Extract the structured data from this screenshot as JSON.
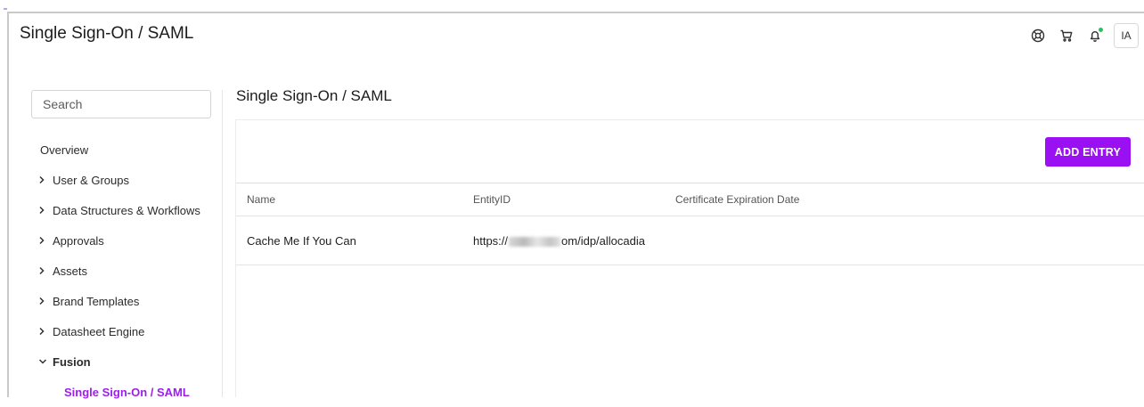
{
  "app": {
    "title": "Single Sign-On / SAML",
    "avatar_initials": "IA"
  },
  "header_icons": [
    "help-icon",
    "cart-icon",
    "bell-icon"
  ],
  "sidebar": {
    "search_placeholder": "Search",
    "items": [
      {
        "label": "Overview",
        "type": "plain"
      },
      {
        "label": "User & Groups",
        "type": "collapsed"
      },
      {
        "label": "Data Structures & Workflows",
        "type": "collapsed"
      },
      {
        "label": "Approvals",
        "type": "collapsed"
      },
      {
        "label": "Assets",
        "type": "collapsed"
      },
      {
        "label": "Brand Templates",
        "type": "collapsed"
      },
      {
        "label": "Datasheet Engine",
        "type": "collapsed"
      },
      {
        "label": "Fusion",
        "type": "expanded"
      },
      {
        "label": "Single Sign-On / SAML",
        "type": "active-sub"
      }
    ]
  },
  "main": {
    "page_title": "Single Sign-On / SAML",
    "add_button_label": "ADD ENTRY",
    "table": {
      "columns": [
        "Name",
        "EntityID",
        "Certificate Expiration Date"
      ],
      "rows": [
        {
          "name": "Cache Me If You Can",
          "entity_prefix": "https://",
          "entity_suffix": "om/idp/allocadia",
          "expiration": ""
        }
      ]
    }
  },
  "colors": {
    "accent": "#9b10f2",
    "notification": "#22c55e"
  }
}
